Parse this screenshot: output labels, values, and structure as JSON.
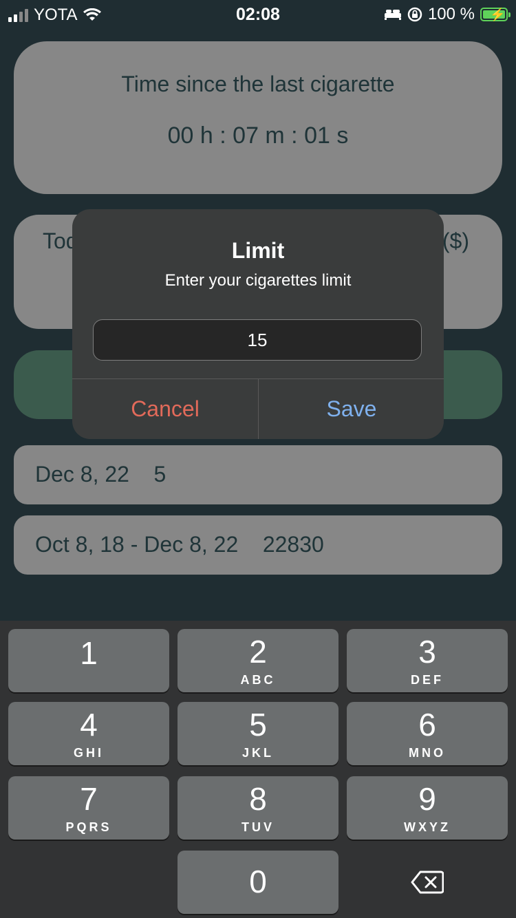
{
  "status_bar": {
    "carrier": "YOTA",
    "time": "02:08",
    "battery_percent": "100 %",
    "icons": [
      "signal-icon",
      "wifi-icon",
      "bed-icon",
      "orientation-lock-icon",
      "battery-charging-icon"
    ]
  },
  "timer_card": {
    "label": "Time since the last cigarette",
    "value": "00 h : 07 m : 01 s"
  },
  "today_card": {
    "left_text_partial": "Tod",
    "right_text_partial": "($)"
  },
  "history": [
    {
      "text": "Dec 8, 22    5"
    },
    {
      "text": "Oct 8, 18 - Dec 8, 22    22830"
    }
  ],
  "dialog": {
    "title": "Limit",
    "message": "Enter your cigarettes limit",
    "input_value": "15",
    "cancel_label": "Cancel",
    "save_label": "Save",
    "colors": {
      "cancel": "#e26a5a",
      "save": "#7fb1ee"
    }
  },
  "keyboard": {
    "keys": [
      {
        "num": "1",
        "letters": ""
      },
      {
        "num": "2",
        "letters": "ABC"
      },
      {
        "num": "3",
        "letters": "DEF"
      },
      {
        "num": "4",
        "letters": "GHI"
      },
      {
        "num": "5",
        "letters": "JKL"
      },
      {
        "num": "6",
        "letters": "MNO"
      },
      {
        "num": "7",
        "letters": "PQRS"
      },
      {
        "num": "8",
        "letters": "TUV"
      },
      {
        "num": "9",
        "letters": "WXYZ"
      },
      {
        "num": "0",
        "letters": ""
      }
    ],
    "backspace_icon": "backspace-icon"
  }
}
